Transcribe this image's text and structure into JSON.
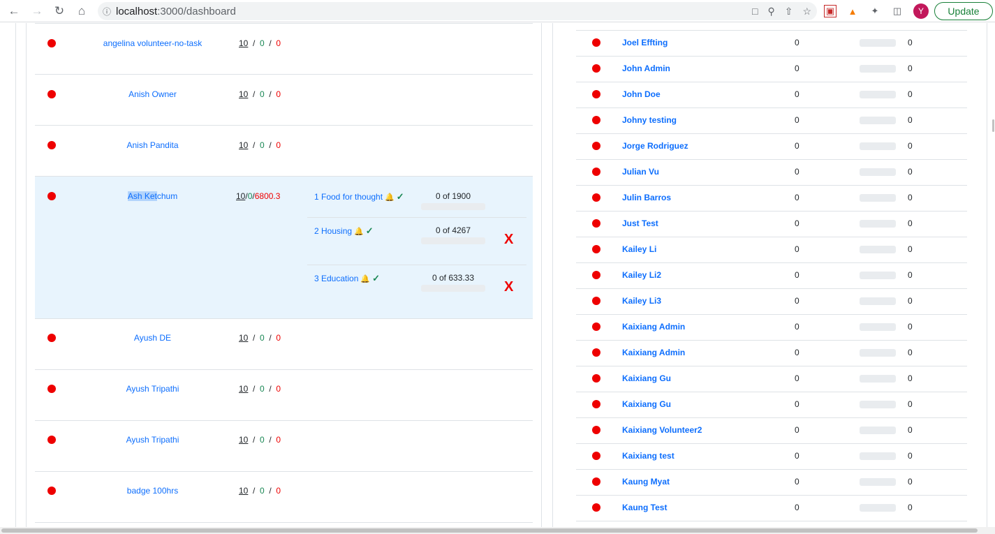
{
  "browser": {
    "url_host": "localhost",
    "url_path": ":3000/dashboard",
    "avatar_letter": "Y",
    "update_label": "Update"
  },
  "left_rows": [
    {
      "name": "angelina volunteer-no-task",
      "a": "10",
      "b": "0",
      "c": "0"
    },
    {
      "name": "Anish Owner",
      "a": "10",
      "b": "0",
      "c": "0"
    },
    {
      "name": "Anish Pandita",
      "a": "10",
      "b": "0",
      "c": "0"
    },
    {
      "name_sel": "Ash Ket",
      "name_rest": "chum",
      "a": "10",
      "b": "0",
      "c": "6800.3",
      "tasks": [
        {
          "name": "1 Food for thought",
          "value": "0 of 1900",
          "has_x": false
        },
        {
          "name": "2 Housing",
          "value": "0 of 4267",
          "has_x": true
        },
        {
          "name": "3 Education",
          "value": "0 of 633.33",
          "has_x": true
        }
      ]
    },
    {
      "name": "Ayush DE",
      "a": "10",
      "b": "0",
      "c": "0"
    },
    {
      "name": "Ayush Tripathi",
      "a": "10",
      "b": "0",
      "c": "0"
    },
    {
      "name": "Ayush Tripathi",
      "a": "10",
      "b": "0",
      "c": "0"
    },
    {
      "name": "badge 100hrs",
      "a": "10",
      "b": "0",
      "c": "0"
    }
  ],
  "x_mark": "X",
  "right_rows": [
    {
      "name": "Joel Effting",
      "v1": "0",
      "v2": "0"
    },
    {
      "name": "John Admin",
      "v1": "0",
      "v2": "0"
    },
    {
      "name": "John Doe",
      "v1": "0",
      "v2": "0"
    },
    {
      "name": "Johny testing",
      "v1": "0",
      "v2": "0"
    },
    {
      "name": "Jorge Rodriguez",
      "v1": "0",
      "v2": "0"
    },
    {
      "name": "Julian Vu",
      "v1": "0",
      "v2": "0"
    },
    {
      "name": "Julin Barros",
      "v1": "0",
      "v2": "0"
    },
    {
      "name": "Just Test",
      "v1": "0",
      "v2": "0"
    },
    {
      "name": "Kailey Li",
      "v1": "0",
      "v2": "0"
    },
    {
      "name": "Kailey Li2",
      "v1": "0",
      "v2": "0"
    },
    {
      "name": "Kailey Li3",
      "v1": "0",
      "v2": "0"
    },
    {
      "name": "Kaixiang Admin",
      "v1": "0",
      "v2": "0"
    },
    {
      "name": "Kaixiang Admin",
      "v1": "0",
      "v2": "0"
    },
    {
      "name": "Kaixiang Gu",
      "v1": "0",
      "v2": "0"
    },
    {
      "name": "Kaixiang Gu",
      "v1": "0",
      "v2": "0"
    },
    {
      "name": "Kaixiang Volunteer2",
      "v1": "0",
      "v2": "0"
    },
    {
      "name": "Kaixiang test",
      "v1": "0",
      "v2": "0"
    },
    {
      "name": "Kaung Myat",
      "v1": "0",
      "v2": "0"
    },
    {
      "name": "Kaung Test",
      "v1": "0",
      "v2": "0"
    }
  ]
}
